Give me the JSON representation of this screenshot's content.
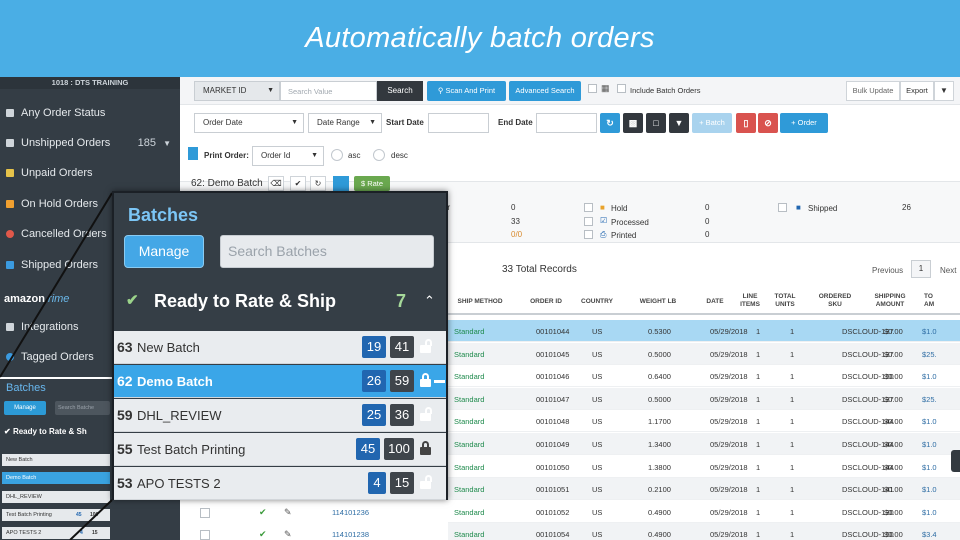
{
  "banner": {
    "title": "Automatically batch orders"
  },
  "sidebar": {
    "account": "1018 : DTS TRAINING",
    "items": [
      {
        "label": "Any Order Status",
        "count": "",
        "icon_color": "#cfd5da"
      },
      {
        "label": "Unshipped Orders",
        "count": "185",
        "icon_color": "#cfd5da"
      },
      {
        "label": "Unpaid Orders",
        "count": "",
        "icon_color": "#e6c34a"
      },
      {
        "label": "On Hold Orders",
        "count": "",
        "icon_color": "#f0a030"
      },
      {
        "label": "Cancelled Orders",
        "count": "",
        "icon_color": "#e0584a"
      },
      {
        "label": "Shipped Orders",
        "count": "",
        "icon_color": "#3b9be0"
      },
      {
        "label": "Integrations",
        "count": "",
        "icon_color": "#cfd5da"
      },
      {
        "label": "Tagged Orders",
        "count": "",
        "icon_color": "#3b9be0"
      }
    ],
    "amazon": "amazon",
    "amazon_prime": "rime"
  },
  "mini": {
    "title": "Batches",
    "manage": "Manage",
    "search": "Search Batche",
    "group": "Ready to Rate & Sh",
    "rows": [
      "New Batch",
      "Demo Batch",
      "DHL_REVIEW",
      "Test Batch Printing",
      "APO TESTS 2"
    ],
    "badges": [
      "45",
      "100",
      "4",
      "15"
    ]
  },
  "toolbar": {
    "market_select": "MARKET ID",
    "search_placeholder": "Search Value",
    "search_btn": "Search",
    "scan_btn": "Scan And Print",
    "advanced_btn": "Advanced Search",
    "include_batch": "Include Batch Orders",
    "bulk_update": "Bulk Update",
    "export": "Export",
    "order_date": "Order Date",
    "date_range": "Date Range",
    "start_date": "Start Date",
    "end_date": "End Date",
    "batch_btn": "+ Batch",
    "order_btn": "+ Order",
    "print_order": "Print Order:",
    "order_id": "Order Id",
    "asc": "asc",
    "desc": "desc"
  },
  "batch_bar": {
    "name": "62: Demo Batch",
    "rate": "$ Rate"
  },
  "stats": {
    "or_label": "or",
    "vals": [
      "0",
      "33",
      "0/0"
    ],
    "hold": "Hold",
    "hold_val": "0",
    "processed": "Processed",
    "processed_val": "0",
    "printed": "Printed",
    "printed_val": "0",
    "shipped": "Shipped",
    "shipped_val": "26"
  },
  "records": {
    "total": "33 Total Records",
    "previous": "Previous",
    "page": "1",
    "next": "Next"
  },
  "table": {
    "headers": [
      "SHIP METHOD",
      "ORDER ID",
      "COUNTRY",
      "WEIGHT LB",
      "DATE",
      "LINE ITEMS",
      "TOTAL UNITS",
      "ORDERED SKU",
      "SHIPPING AMOUNT",
      "TO AM"
    ],
    "rows": [
      {
        "method": "Standard",
        "id": "00101044",
        "country": "US",
        "weight": "0.5300",
        "date": "05/29/2018",
        "lines": "1",
        "units": "1",
        "sku": "DSCLOUD-137",
        "ship": "$0.00",
        "total": "$1.0"
      },
      {
        "method": "Standard",
        "id": "00101045",
        "country": "US",
        "weight": "0.5000",
        "date": "05/29/2018",
        "lines": "1",
        "units": "1",
        "sku": "DSCLOUD-137",
        "ship": "$0.00",
        "total": "$25."
      },
      {
        "method": "Standard",
        "id": "00101046",
        "country": "US",
        "weight": "0.6400",
        "date": "05/29/2018",
        "lines": "1",
        "units": "1",
        "sku": "DSCLOUD-150",
        "ship": "$0.00",
        "total": "$1.0"
      },
      {
        "method": "Standard",
        "id": "00101047",
        "country": "US",
        "weight": "0.5000",
        "date": "05/29/2018",
        "lines": "1",
        "units": "1",
        "sku": "DSCLOUD-137",
        "ship": "$0.00",
        "total": "$25."
      },
      {
        "method": "Standard",
        "id": "00101048",
        "country": "US",
        "weight": "1.1700",
        "date": "05/29/2018",
        "lines": "1",
        "units": "1",
        "sku": "DSCLOUD-144",
        "ship": "$0.00",
        "total": "$1.0"
      },
      {
        "method": "Standard",
        "id": "00101049",
        "country": "US",
        "weight": "1.3400",
        "date": "05/29/2018",
        "lines": "1",
        "units": "1",
        "sku": "DSCLOUD-144",
        "ship": "$0.00",
        "total": "$1.0"
      },
      {
        "method": "Standard",
        "id": "00101050",
        "country": "US",
        "weight": "1.3800",
        "date": "05/29/2018",
        "lines": "1",
        "units": "1",
        "sku": "DSCLOUD-144",
        "ship": "$0.00",
        "total": "$1.0"
      },
      {
        "method": "Standard",
        "id": "00101051",
        "country": "US",
        "weight": "0.2100",
        "date": "05/29/2018",
        "lines": "1",
        "units": "1",
        "sku": "DSCLOUD-141",
        "ship": "$0.00",
        "total": "$1.0"
      },
      {
        "method": "Standard",
        "id": "00101052",
        "country": "US",
        "weight": "0.4900",
        "date": "05/29/2018",
        "lines": "1",
        "units": "1",
        "sku": "DSCLOUD-130",
        "ship": "$0.00",
        "total": "$1.0"
      },
      {
        "method": "Standard",
        "id": "00101054",
        "country": "US",
        "weight": "0.4900",
        "date": "05/29/2018",
        "lines": "1",
        "units": "1",
        "sku": "DSCLOUD-150",
        "ship": "$0.00",
        "total": "$3.4"
      }
    ],
    "left_ids": [
      "114101236",
      "114101238"
    ]
  },
  "popup": {
    "title": "Batches",
    "manage": "Manage",
    "search_placeholder": "Search Batches",
    "group": {
      "label": "Ready to Rate & Ship",
      "count": "7"
    },
    "rows": [
      {
        "num": "63",
        "name": "New Batch",
        "a": "19",
        "b": "41",
        "locked": false,
        "selected": false
      },
      {
        "num": "62",
        "name": "Demo Batch",
        "a": "26",
        "b": "59",
        "locked": false,
        "selected": true
      },
      {
        "num": "59",
        "name": "DHL_REVIEW",
        "a": "25",
        "b": "36",
        "locked": false,
        "selected": false
      },
      {
        "num": "55",
        "name": "Test Batch Printing",
        "a": "45",
        "b": "100",
        "locked": true,
        "selected": false
      },
      {
        "num": "53",
        "name": "APO TESTS 2",
        "a": "4",
        "b": "15",
        "locked": false,
        "selected": false
      }
    ]
  },
  "colors": {
    "accent": "#2f9ad8",
    "banner": "#4aaee5",
    "sidebar": "#343d45",
    "selected_row": "#a8d8f3"
  }
}
